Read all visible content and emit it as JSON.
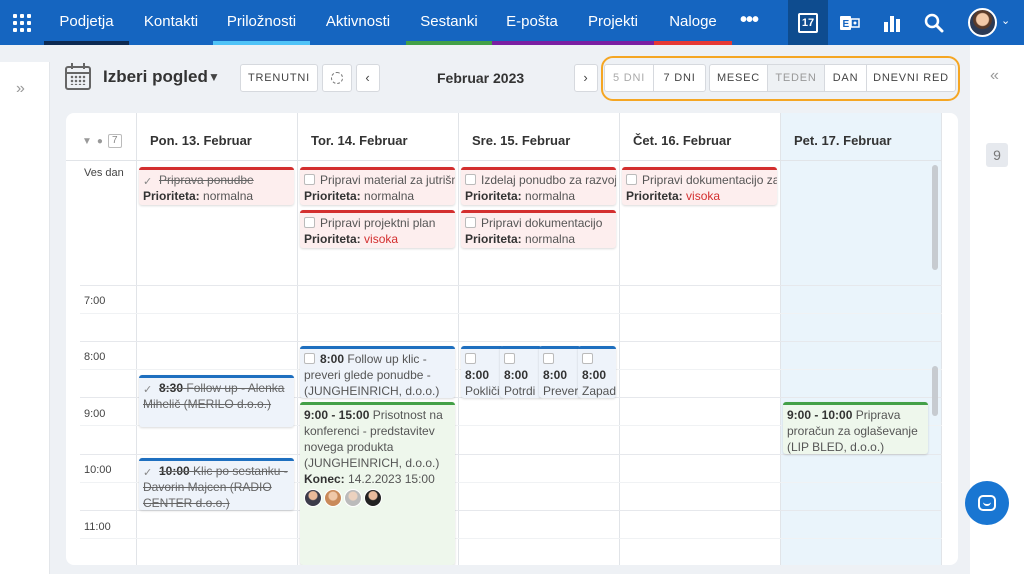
{
  "nav": {
    "items": [
      {
        "label": "Podjetja",
        "color": "#0d2a52"
      },
      {
        "label": "Kontakti",
        "color": "#1565c0"
      },
      {
        "label": "Priložnosti",
        "color": "#4fc3f7"
      },
      {
        "label": "Aktivnosti",
        "color": "#1565c0"
      },
      {
        "label": "Sestanki",
        "color": "#43a047"
      },
      {
        "label": "E-pošta",
        "color": "#7b1fa2"
      },
      {
        "label": "Projekti",
        "color": "#7b1fa2"
      },
      {
        "label": "Naloge",
        "color": "#e53935"
      }
    ],
    "more": "•••",
    "calendar_day": "17"
  },
  "toolbar": {
    "view_title": "Izberi pogled",
    "today": "TRENUTNI",
    "period": "Februar 2023",
    "days_group": [
      "5 DNI",
      "7 DNI"
    ],
    "views_group": [
      "MESEC",
      "TEDEN",
      "DAN",
      "DNEVNI RED"
    ],
    "selected_view": "TEDEN"
  },
  "header": {
    "count": "7",
    "days": [
      "Pon. 13. Februar",
      "Tor. 14. Februar",
      "Sre. 15. Februar",
      "Čet. 16. Februar",
      "Pet. 17. Februar"
    ]
  },
  "allday_label": "Ves dan",
  "times": [
    "7:00",
    "8:00",
    "9:00",
    "10:00",
    "11:00"
  ],
  "right_badge": "9",
  "events": {
    "mon_allday": {
      "title": "Priprava ponudbe",
      "prio_label": "Prioriteta:",
      "prio": "normalna"
    },
    "tue_allday_1": {
      "title": "Pripravi material za jutrišnji sestanek",
      "prio_label": "Prioriteta:",
      "prio": "normalna"
    },
    "tue_allday_2": {
      "title": "Pripravi projektni plan",
      "prio_label": "Prioriteta:",
      "prio": "visoka"
    },
    "wed_allday_1": {
      "title": "Izdelaj ponudbo za razvoj",
      "prio_label": "Prioriteta:",
      "prio": "normalna"
    },
    "wed_allday_2": {
      "title": "Pripravi dokumentacijo",
      "prio_label": "Prioriteta:",
      "prio": "normalna"
    },
    "thu_allday": {
      "title": "Pripravi dokumentacijo za",
      "prio_label": "Prioriteta:",
      "prio": "visoka"
    },
    "mon_830": {
      "time": "8:30",
      "title": "Follow up - Alenka Mihelič (MERILO d.o.o.)"
    },
    "mon_1000": {
      "time": "10:00",
      "title": "Klic po sestanku - Davorin Majcen (RADIO CENTER d.o.o.)"
    },
    "tue_800": {
      "time": "8:00",
      "title": "Follow up klic - preveri glede ponudbe - (JUNGHEINRICH, d.o.o.)"
    },
    "tue_900": {
      "time": "9:00 - 15:00",
      "title": "Prisotnost na konferenci - predstavitev novega produkta (JUNGHEINRICH, d.o.o.)",
      "end_label": "Konec:",
      "end": "14.2.2023 15:00"
    },
    "wed_a": {
      "time": "8:00",
      "title": "Pokliči glede"
    },
    "wed_b": {
      "time": "8:00",
      "title": "Potrdi sestan"
    },
    "wed_c": {
      "time": "8:00",
      "title": "Prever glede"
    },
    "wed_d": {
      "time": "8:00",
      "title": "Zapad"
    },
    "fri_900": {
      "time": "9:00 - 10:00",
      "title": "Priprava proračun za oglaševanje (LIP BLED, d.o.o.)"
    }
  }
}
